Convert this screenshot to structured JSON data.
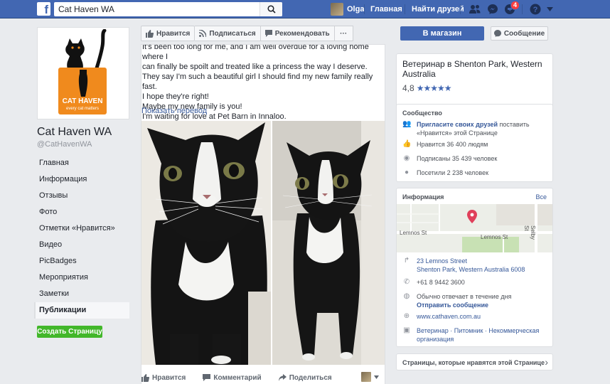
{
  "topbar": {
    "search_value": "Cat Haven WA",
    "user_name": "Olga",
    "home_label": "Главная",
    "find_friends_label": "Найти друзей",
    "notifications_count": "4"
  },
  "sidebar": {
    "logo_text": "CAT HAVEN",
    "logo_sub": "every cat matters",
    "page_name": "Cat Haven WA",
    "page_handle": "@CatHavenWA",
    "items": [
      {
        "label": "Главная"
      },
      {
        "label": "Информация"
      },
      {
        "label": "Отзывы"
      },
      {
        "label": "Фото"
      },
      {
        "label": "Отметки «Нравится»"
      },
      {
        "label": "Видео"
      },
      {
        "label": "PicBadges"
      },
      {
        "label": "Мероприятия"
      },
      {
        "label": "Заметки"
      },
      {
        "label": "Публикации"
      }
    ],
    "create_page_label": "Создать Страницу"
  },
  "actions": {
    "like": "Нравится",
    "follow": "Подписаться",
    "recommend": "Рекомендовать",
    "more": "···"
  },
  "post": {
    "lines": [
      "It's been too long for me, and I am well overdue for a loving home where I",
      "can finally be spoilt and treated like a princess the way I deserve.",
      "They say I'm such a beautiful girl I should find my new family really fast.",
      "I hope they're right!",
      "Maybe my new family is you!",
      "I'm waiting for love at Pet Barn in Innaloo."
    ],
    "translate_label": "Показать перевод",
    "footer": {
      "like": "Нравится",
      "comment": "Комментарий",
      "share": "Поделиться"
    }
  },
  "right": {
    "shop_label": "В магазин",
    "message_label": "Сообщение",
    "category": "Ветеринар в Shenton Park, Western Australia",
    "rating": "4,8",
    "community": {
      "title": "Сообщество",
      "invite_link": "Пригласите своих друзей",
      "invite_rest": " поставить «Нравится» этой Странице",
      "likes": "Нравится 36 400 людям",
      "follows": "Подписаны 35 439 человек",
      "visits": "Посетили 2 238 человек"
    },
    "info": {
      "title": "Информация",
      "see_all": "Все",
      "map_street_left": "Lemnos St",
      "map_street_right": "Lemnos St",
      "map_street_vertical": "Selby St",
      "address1": "23 Lemnos Street",
      "address2": "Shenton Park, Western Australia 6008",
      "phone": "+61 8 9442 3600",
      "response": "Обычно отвечает в течение дня",
      "send_message": "Отправить сообщение",
      "website": "www.cathaven.com.au",
      "categories": "Ветеринар · Питомник · Некоммерческая организация"
    },
    "liked_pages_title": "Страницы, которые нравятся этой Странице"
  },
  "colors": {
    "brand_blue": "#4267b2",
    "green": "#42b72a",
    "logo_orange": "#f08a1d",
    "link": "#365899"
  }
}
